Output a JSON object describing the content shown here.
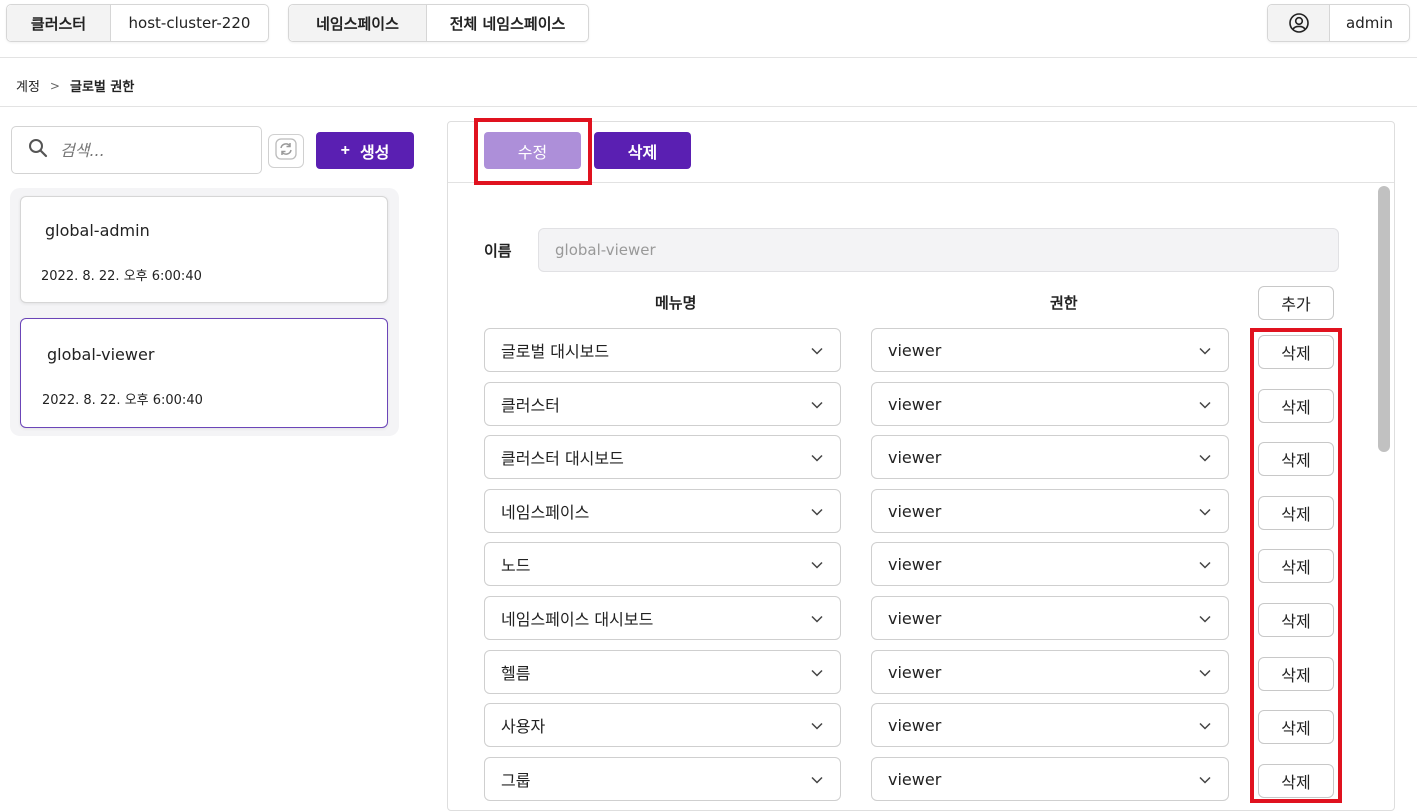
{
  "topbar": {
    "cluster_label": "클러스터",
    "cluster_value": "host-cluster-220",
    "namespace_label": "네임스페이스",
    "namespace_value": "전체 네임스페이스",
    "user_icon": "user-circle-icon",
    "user_name": "admin"
  },
  "breadcrumb": {
    "parent": "계정",
    "current": "글로벌 권한"
  },
  "sidebar": {
    "search_placeholder": "검색...",
    "create_label": "생성",
    "items": [
      {
        "name": "global-admin",
        "date": "2022. 8. 22. 오후 6:00:40",
        "selected": false
      },
      {
        "name": "global-viewer",
        "date": "2022. 8. 22. 오후 6:00:40",
        "selected": true
      }
    ]
  },
  "detail": {
    "edit_label": "수정",
    "delete_label": "삭제",
    "name_label": "이름",
    "name_value": "global-viewer",
    "col_menu": "메뉴명",
    "col_permission": "권한",
    "add_label": "추가",
    "row_delete_label": "삭제",
    "rows": [
      {
        "menu": "글로벌 대시보드",
        "permission": "viewer"
      },
      {
        "menu": "클러스터",
        "permission": "viewer"
      },
      {
        "menu": "클러스터 대시보드",
        "permission": "viewer"
      },
      {
        "menu": "네임스페이스",
        "permission": "viewer"
      },
      {
        "menu": "노드",
        "permission": "viewer"
      },
      {
        "menu": "네임스페이스 대시보드",
        "permission": "viewer"
      },
      {
        "menu": "헬름",
        "permission": "viewer"
      },
      {
        "menu": "사용자",
        "permission": "viewer"
      },
      {
        "menu": "그룹",
        "permission": "viewer"
      }
    ]
  },
  "colors": {
    "accent": "#5a1fb2",
    "accent_light": "#ad8fd9",
    "highlight": "#e0121f"
  }
}
